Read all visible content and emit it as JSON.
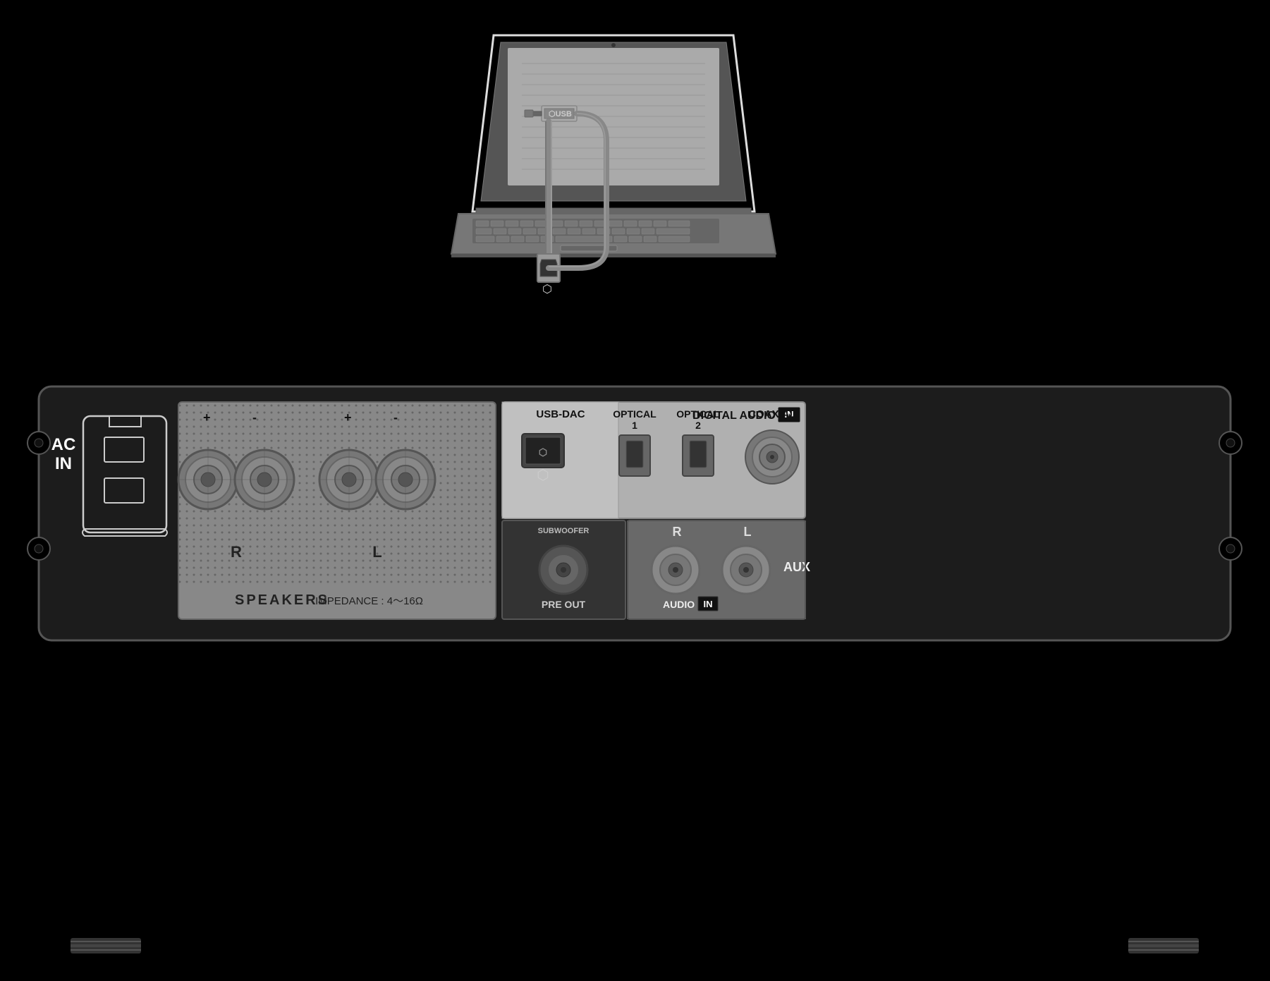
{
  "labels": {
    "ac_in": "AC\nIN",
    "ac_in_line1": "AC",
    "ac_in_line2": "IN",
    "speakers": "SPEAKERS",
    "impedance": "IMPEDANCE : 4～16Ω",
    "digital_audio": "DIGITAL  AUDIO",
    "in": "IN",
    "usb_dac": "USB-DAC",
    "optical1": "OPTICAL\n1",
    "optical1_line1": "OPTICAL",
    "optical1_line2": "1",
    "optical2": "OPTICAL\n2",
    "optical2_line1": "OPTICAL",
    "optical2_line2": "2",
    "coaxial": "COAXIAL",
    "pre_out": "PRE OUT",
    "subwoofer": "SUBWOOFER",
    "audio": "AUDIO",
    "aux": "AUX",
    "r_label": "R",
    "l_label": "L",
    "speaker_r": "R",
    "speaker_l": "L",
    "speaker_plus1": "+",
    "speaker_minus1": "-",
    "speaker_plus2": "+",
    "speaker_minus2": "-",
    "usb_symbol": "⬡",
    "usb_connector_symbol": "⚡"
  },
  "colors": {
    "background": "#000000",
    "amp_body": "#1a1a1a",
    "amp_border": "#555555",
    "speaker_section_bg": "#888888",
    "digital_section_bg": "#aaaaaa",
    "text_light": "#ffffff",
    "text_dark": "#222222"
  }
}
